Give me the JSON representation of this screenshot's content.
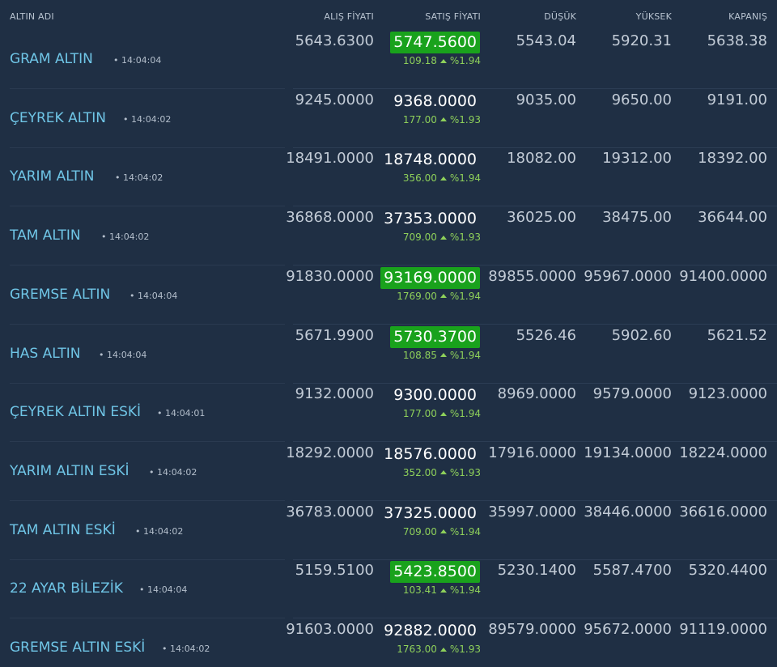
{
  "header": {
    "name": "ALTIN ADI",
    "buy": "ALIŞ FİYATI",
    "sell": "SATIŞ FİYATI",
    "low": "DÜŞÜK",
    "high": "YÜKSEK",
    "close": "KAPANIŞ"
  },
  "colors": {
    "background": "#1f2f44",
    "name": "#6fc5e6",
    "highlight": "#19a21c",
    "change": "#8ed05a"
  },
  "rows": [
    {
      "name": "GRAM ALTIN",
      "time": "• 14:04:04",
      "buy": "5643.6300",
      "sell": "5747.5600",
      "highlight": true,
      "change": "109.18",
      "pct": "%1.94",
      "low": "5543.04",
      "high": "5920.31",
      "close": "5638.38"
    },
    {
      "name": "ÇEYREK ALTIN",
      "time": "• 14:04:02",
      "buy": "9245.0000",
      "sell": "9368.0000",
      "highlight": false,
      "change": "177.00",
      "pct": "%1.93",
      "low": "9035.00",
      "high": "9650.00",
      "close": "9191.00"
    },
    {
      "name": "YARIM ALTIN",
      "time": "• 14:04:02",
      "buy": "18491.0000",
      "sell": "18748.0000",
      "highlight": false,
      "change": "356.00",
      "pct": "%1.94",
      "low": "18082.00",
      "high": "19312.00",
      "close": "18392.00"
    },
    {
      "name": "TAM ALTIN",
      "time": "• 14:04:02",
      "buy": "36868.0000",
      "sell": "37353.0000",
      "highlight": false,
      "change": "709.00",
      "pct": "%1.93",
      "low": "36025.00",
      "high": "38475.00",
      "close": "36644.00"
    },
    {
      "name": "GREMSE ALTIN",
      "time": "• 14:04:04",
      "buy": "91830.0000",
      "sell": "93169.0000",
      "highlight": true,
      "change": "1769.00",
      "pct": "%1.94",
      "low": "89855.0000",
      "high": "95967.0000",
      "close": "91400.0000"
    },
    {
      "name": "HAS ALTIN",
      "time": "• 14:04:04",
      "buy": "5671.9900",
      "sell": "5730.3700",
      "highlight": true,
      "change": "108.85",
      "pct": "%1.94",
      "low": "5526.46",
      "high": "5902.60",
      "close": "5621.52"
    },
    {
      "name": "ÇEYREK ALTIN ESKİ",
      "time": "• 14:04:01",
      "buy": "9132.0000",
      "sell": "9300.0000",
      "highlight": false,
      "change": "177.00",
      "pct": "%1.94",
      "low": "8969.0000",
      "high": "9579.0000",
      "close": "9123.0000"
    },
    {
      "name": "YARIM ALTIN ESKİ",
      "time": "• 14:04:02",
      "buy": "18292.0000",
      "sell": "18576.0000",
      "highlight": false,
      "change": "352.00",
      "pct": "%1.93",
      "low": "17916.0000",
      "high": "19134.0000",
      "close": "18224.0000"
    },
    {
      "name": "TAM ALTIN ESKİ",
      "time": "• 14:04:02",
      "buy": "36783.0000",
      "sell": "37325.0000",
      "highlight": false,
      "change": "709.00",
      "pct": "%1.94",
      "low": "35997.0000",
      "high": "38446.0000",
      "close": "36616.0000"
    },
    {
      "name": "22 AYAR BİLEZİK",
      "time": "• 14:04:04",
      "buy": "5159.5100",
      "sell": "5423.8500",
      "highlight": true,
      "change": "103.41",
      "pct": "%1.94",
      "low": "5230.1400",
      "high": "5587.4700",
      "close": "5320.4400"
    },
    {
      "name": "GREMSE ALTIN ESKİ",
      "time": "• 14:04:02",
      "buy": "91603.0000",
      "sell": "92882.0000",
      "highlight": false,
      "change": "1763.00",
      "pct": "%1.93",
      "low": "89579.0000",
      "high": "95672.0000",
      "close": "91119.0000"
    }
  ]
}
